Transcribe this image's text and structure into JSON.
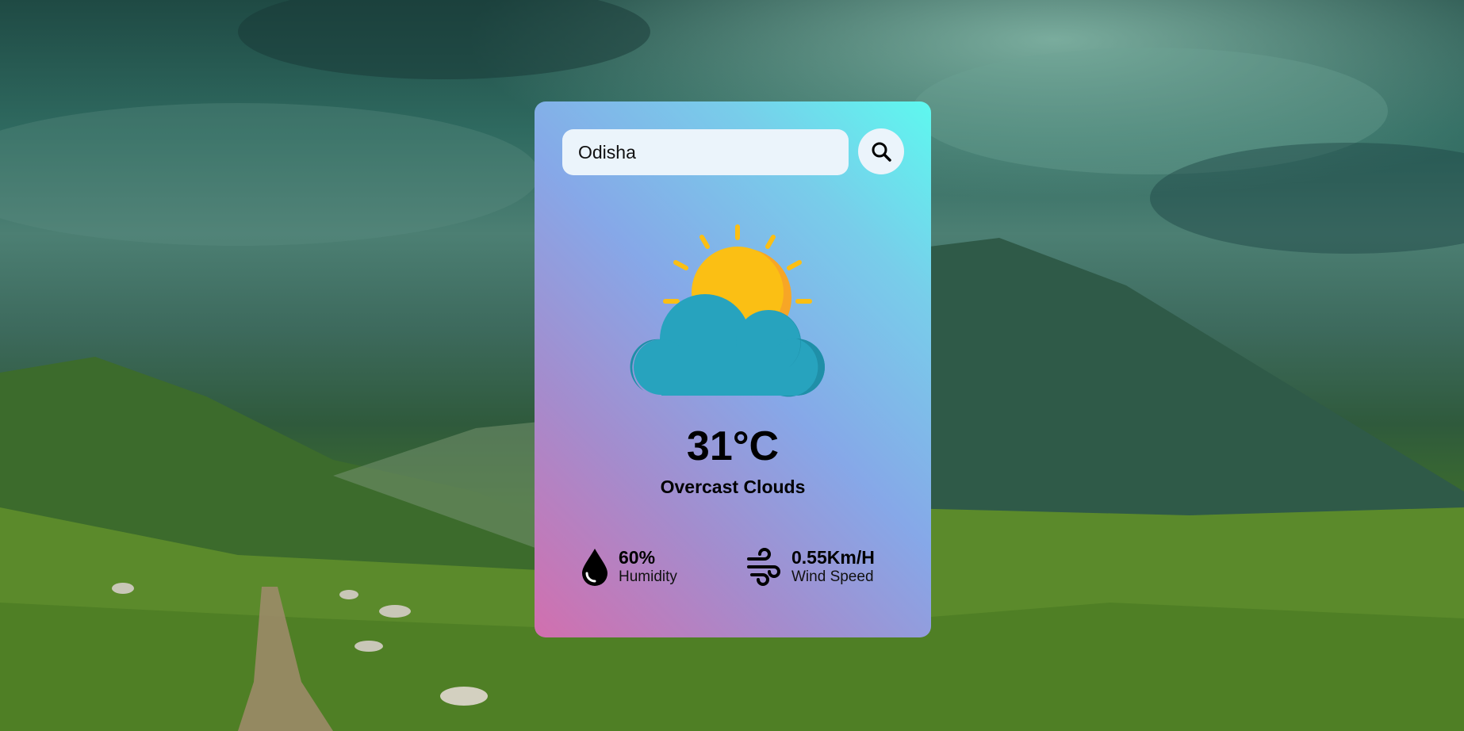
{
  "search": {
    "value": "Odisha",
    "placeholder": "",
    "button_icon": "search-icon"
  },
  "weather": {
    "icon": "partly-cloudy-icon",
    "temperature": "31°C",
    "description": "Overcast Clouds"
  },
  "details": {
    "humidity": {
      "icon": "water-drop-icon",
      "value": "60%",
      "label": "Humidity"
    },
    "wind": {
      "icon": "wind-icon",
      "value": "0.55Km/H",
      "label": "Wind Speed"
    }
  },
  "colors": {
    "card_gradient": [
      "#d26fae",
      "#86a8e8",
      "#5ef8ef"
    ],
    "input_bg": "#ebf4fb",
    "sun": "#fbbf14",
    "cloud": "#27a3be"
  }
}
